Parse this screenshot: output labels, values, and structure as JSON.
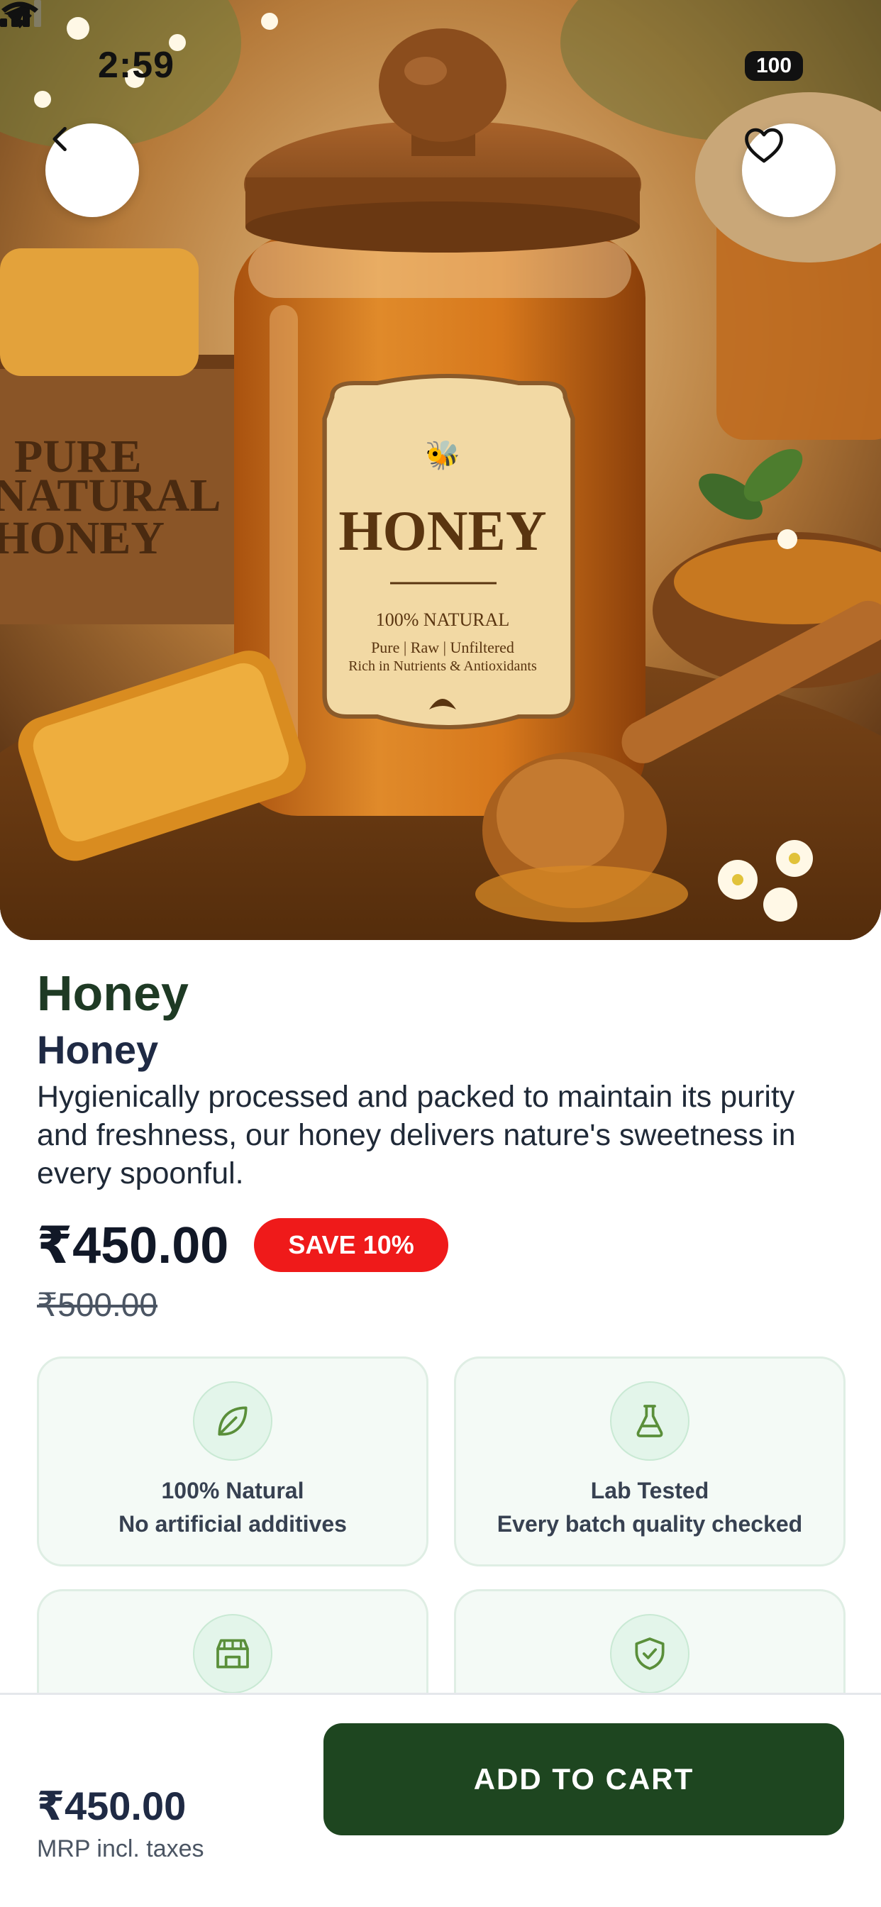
{
  "status_bar": {
    "time": "2:59",
    "battery": "100"
  },
  "hero": {
    "crate_text": [
      "PURE",
      "NATURAL",
      "HONEY"
    ],
    "label": {
      "title": "HONEY",
      "line1": "100% NATURAL",
      "line2": "Pure | Raw | Unfiltered",
      "line3": "Rich in Nutrients & Antioxidants"
    }
  },
  "product": {
    "name": "Honey",
    "subname": "Honey",
    "description": "Hygienically processed and packed to maintain its purity and freshness, our honey delivers nature's sweetness in every spoonful.",
    "price": "₹450.00",
    "save_badge": "SAVE 10%",
    "mrp": "₹500.00"
  },
  "features": [
    {
      "icon": "leaf-icon",
      "title": "100% Natural",
      "subtitle": "No artificial additives"
    },
    {
      "icon": "flask-icon",
      "title": "Lab Tested",
      "subtitle": "Every batch quality checked"
    },
    {
      "icon": "store-icon"
    },
    {
      "icon": "shield-check-icon"
    }
  ],
  "bottom_bar": {
    "price": "₹450.00",
    "price_note": "MRP incl. taxes",
    "add_to_cart": "ADD TO CART"
  },
  "colors": {
    "brand_green": "#1e4620",
    "save_red": "#ef1a1a",
    "card_bg": "#f4faf6",
    "icon_green": "#5a8f3a"
  }
}
